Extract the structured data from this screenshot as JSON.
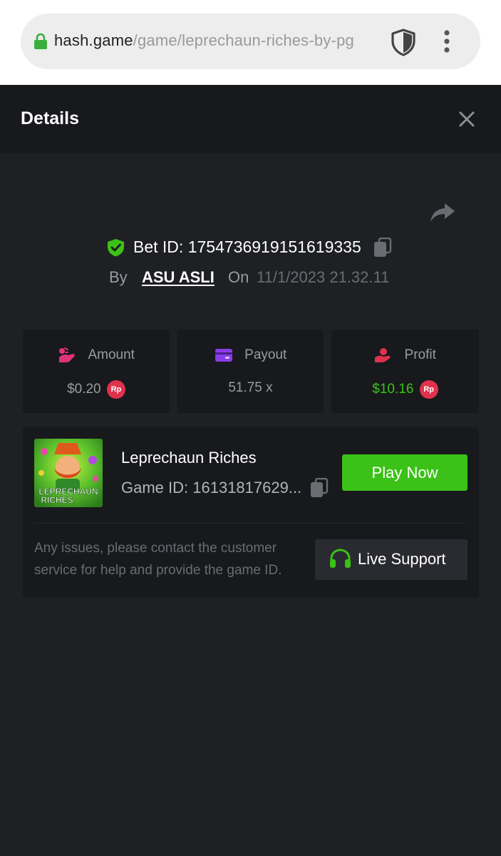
{
  "browser": {
    "url_domain": "hash.game",
    "url_path": "/game/leprechaun-riches-by-pg"
  },
  "header": {
    "title": "Details"
  },
  "bet": {
    "id_label": "Bet ID: 1754736919151619335",
    "by_label": "By",
    "user": "ASU ASLI",
    "on_label": "On",
    "date": "11/1/2023 21.32.11"
  },
  "stats": {
    "amount": {
      "label": "Amount",
      "value": "$0.20",
      "currency": "Rp"
    },
    "payout": {
      "label": "Payout",
      "value": "51.75 x"
    },
    "profit": {
      "label": "Profit",
      "value": "$10.16",
      "currency": "Rp"
    }
  },
  "game": {
    "thumb_title": [
      "LEPRECHAUN",
      "RICHES"
    ],
    "name": "Leprechaun Riches",
    "id_label": "Game ID: 16131817629...",
    "play_label": "Play Now",
    "help_text": "Any issues, please contact the customer service for help and provide the game ID.",
    "support_label": "Live Support"
  },
  "colors": {
    "accent_green": "#3bc117",
    "badge_red": "#e0324c",
    "background": "#1f2024",
    "card": "#18191c"
  },
  "icons": [
    "lock-icon",
    "shield-icon",
    "more-vert-icon",
    "close-icon",
    "share-icon",
    "verified-shield-icon",
    "copy-icon",
    "amount-icon",
    "payout-icon",
    "profit-icon",
    "headset-icon"
  ]
}
